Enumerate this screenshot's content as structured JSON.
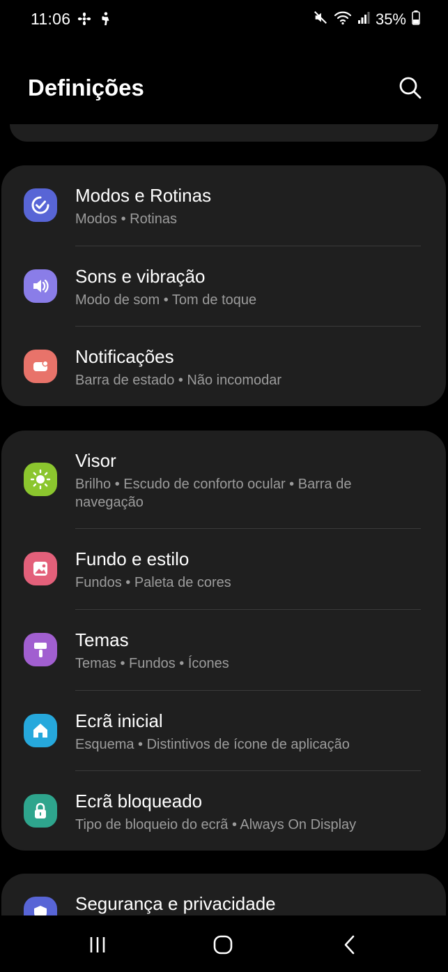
{
  "status_bar": {
    "time": "11:06",
    "battery": "35%",
    "left_icons": [
      "fan-icon",
      "hiker-icon"
    ],
    "right_icons": [
      "mute-icon",
      "wifi-icon",
      "signal-icon",
      "battery-icon"
    ]
  },
  "header": {
    "title": "Definições",
    "search_icon": "search-icon"
  },
  "groups": [
    {
      "items": [
        {
          "title": "Modos e Rotinas",
          "subtitle": "Modos  •  Rotinas",
          "icon": "modes-routines-icon",
          "color": "#5865d6"
        },
        {
          "title": "Sons e vibração",
          "subtitle": "Modo de som  •  Tom de toque",
          "icon": "sound-icon",
          "color": "#8a7de8"
        },
        {
          "title": "Notificações",
          "subtitle": "Barra de estado  •  Não incomodar",
          "icon": "notification-icon",
          "color": "#e8736a"
        }
      ]
    },
    {
      "items": [
        {
          "title": "Visor",
          "subtitle": "Brilho  •  Escudo de conforto ocular  •  Barra de navegação",
          "icon": "brightness-icon",
          "color": "#8bc62e"
        },
        {
          "title": "Fundo e estilo",
          "subtitle": "Fundos  •  Paleta de cores",
          "icon": "wallpaper-icon",
          "color": "#e3607a"
        },
        {
          "title": "Temas",
          "subtitle": "Temas  •  Fundos  •  Ícones",
          "icon": "theme-brush-icon",
          "color": "#a15fd0"
        },
        {
          "title": "Ecrã inicial",
          "subtitle": "Esquema  •  Distintivos de ícone de aplicação",
          "icon": "home-icon",
          "color": "#26a8dc"
        },
        {
          "title": "Ecrã bloqueado",
          "subtitle": "Tipo de bloqueio do ecrã  •  Always On Display",
          "icon": "lock-icon",
          "color": "#2ea58d"
        }
      ]
    },
    {
      "items": [
        {
          "title": "Segurança e privacidade",
          "icon": "shield-icon",
          "color": "#5865d6"
        }
      ]
    }
  ],
  "nav_bar": {
    "recents_icon": "recents-icon",
    "home_icon": "home-button-icon",
    "back_icon": "back-icon"
  }
}
